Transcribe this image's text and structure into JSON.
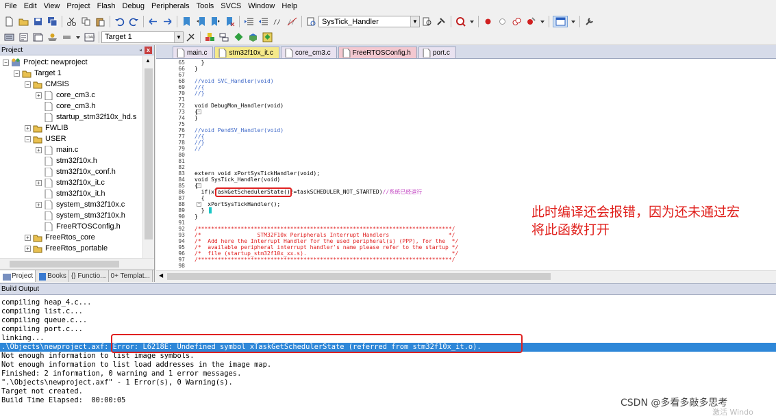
{
  "menubar": [
    "File",
    "Edit",
    "View",
    "Project",
    "Flash",
    "Debug",
    "Peripherals",
    "Tools",
    "SVCS",
    "Window",
    "Help"
  ],
  "toolbar": {
    "function_combo": "SysTick_Handler",
    "target_combo": "Target 1"
  },
  "project_panel": {
    "title": "Project",
    "pin": "ᵸ",
    "close": "x",
    "tree": [
      {
        "label": "Project: newproject"
      },
      {
        "label": "Target 1"
      },
      {
        "label": "CMSIS"
      },
      {
        "label": "core_cm3.c"
      },
      {
        "label": "core_cm3.h"
      },
      {
        "label": "startup_stm32f10x_hd.s"
      },
      {
        "label": "FWLIB"
      },
      {
        "label": "USER"
      },
      {
        "label": "main.c"
      },
      {
        "label": "stm32f10x.h"
      },
      {
        "label": "stm32f10x_conf.h"
      },
      {
        "label": "stm32f10x_it.c"
      },
      {
        "label": "stm32f10x_it.h"
      },
      {
        "label": "system_stm32f10x.c"
      },
      {
        "label": "system_stm32f10x.h"
      },
      {
        "label": "FreeRTOSConfig.h"
      },
      {
        "label": "FreeRtos_core"
      },
      {
        "label": "FreeRtos_portable"
      }
    ],
    "tabs": [
      "Project",
      "Books",
      "{} Functio...",
      "0+ Templat..."
    ]
  },
  "editor": {
    "tabs": [
      {
        "label": "main.c",
        "color": "#e9e2f0"
      },
      {
        "label": "stm32f10x_it.c",
        "color": "#f5e98a"
      },
      {
        "label": "core_cm3.c",
        "color": "#e9e2f0"
      },
      {
        "label": "FreeRTOSConfig.h",
        "color": "#f3c8d0"
      },
      {
        "label": "port.c",
        "color": "#e9e2f0"
      }
    ],
    "line_numbers": [
      "65",
      "66",
      "67",
      "68",
      "69",
      "70",
      "71",
      "72",
      "73",
      "74",
      "75",
      "76",
      "77",
      "78",
      "79",
      "80",
      "81",
      "82",
      "83",
      "84",
      "85",
      "86",
      "87",
      "88",
      "89",
      "90",
      "91",
      "92",
      "93",
      "94",
      "95",
      "96",
      "97",
      "98"
    ],
    "code": {
      "l65": "  }",
      "l66": "}",
      "l68": "//void SVC_Handler(void)",
      "l69": "//{",
      "l70": "//}",
      "l72": "void DebugMon_Handler(void)",
      "l73": "{",
      "l74": "}",
      "l76": "//void PendSV_Handler(void)",
      "l77": "//{",
      "l78": "//}",
      "l79": "//",
      "l83": "extern void xPortSysTickHandler(void);",
      "l84": "void SysTick_Handler(void)",
      "l85": "{",
      "l86a": "  if(",
      "l86b": "xTaskGetSchedulerState",
      "l86c": "()!=taskSCHEDULER_NOT_STARTED)",
      "l86d": "//系统已经运行",
      "l87": "  {",
      "l88": "    xPortSysTickHandler();",
      "l89": "  }",
      "l90": "}",
      "l92": "/*****************************************************************************/",
      "l93": "/*                 STM32F10x Peripherals Interrupt Handlers                  */",
      "l94": "/*  Add here the Interrupt Handler for the used peripheral(s) (PPP), for the  */",
      "l95": "/*  available peripheral interrupt handler's name please refer to the startup */",
      "l96": "/*  file (startup_stm32f10x_xx.s).                                            */",
      "l97": "/*****************************************************************************/"
    },
    "annotation": [
      "此时编译还会报错，因为还未通过宏",
      "将此函数打开"
    ]
  },
  "build_output": {
    "title": "Build Output",
    "lines": [
      "compiling heap_4.c...",
      "compiling list.c...",
      "compiling queue.c...",
      "compiling port.c...",
      "linking...",
      ".\\Objects\\newproject.axf: Error: L6218E: Undefined symbol xTaskGetSchedulerState (referred from stm32f10x_it.o).",
      "Not enough information to list image symbols.",
      "Not enough information to list load addresses in the image map.",
      "Finished: 2 information, 0 warning and 1 error messages.",
      "\".\\Objects\\newproject.axf\" - 1 Error(s), 0 Warning(s).",
      "Target not created.",
      "Build Time Elapsed:  00:00:05"
    ],
    "watermark": "CSDN @多看多敲多思考",
    "watermark2": "激活 Windo"
  },
  "colors": {
    "error_highlight": "#2e87d8",
    "annotation_red": "#e0201c",
    "comment_blue": "#3e68c8"
  }
}
